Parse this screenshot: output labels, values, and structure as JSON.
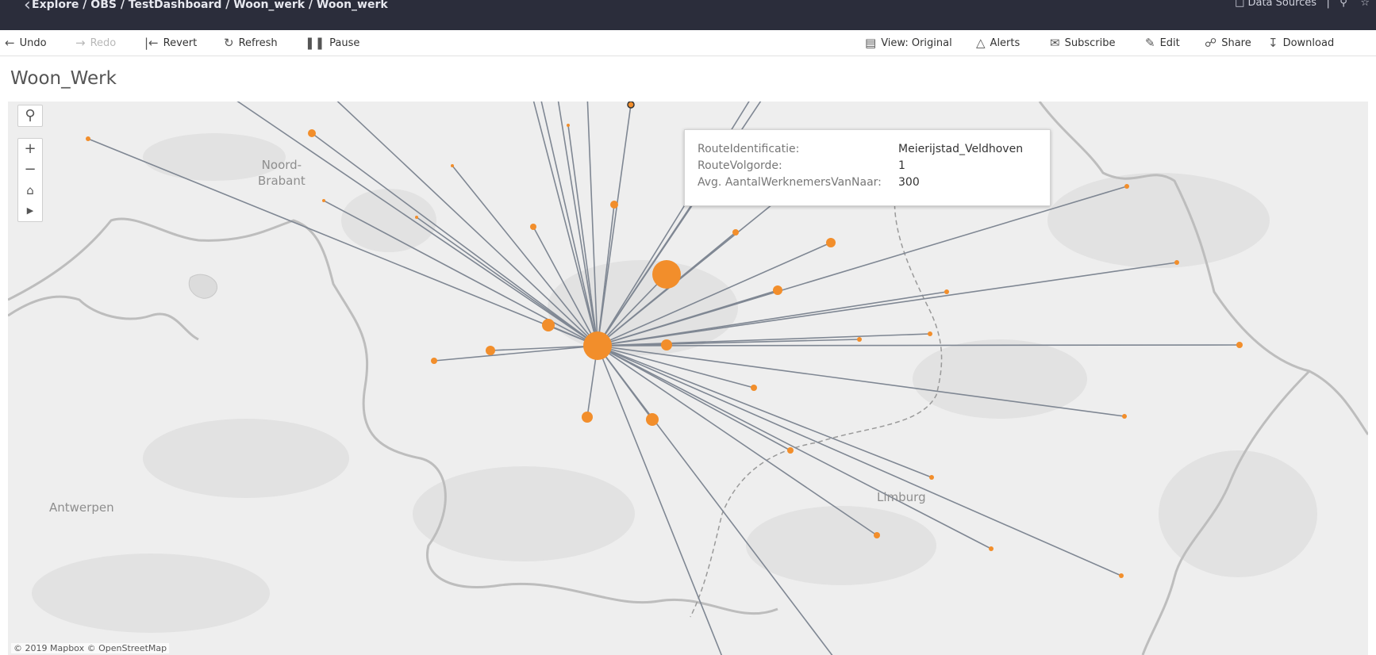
{
  "header": {
    "breadcrumb": "Explore / OBS / TestDashboard / Woon_werk / Woon_werk",
    "data_sources": "Data Sources"
  },
  "toolbar": {
    "undo": "Undo",
    "redo": "Redo",
    "revert": "Revert",
    "refresh": "Refresh",
    "pause": "Pause",
    "view": "View: Original",
    "alerts": "Alerts",
    "subscribe": "Subscribe",
    "edit": "Edit",
    "share": "Share",
    "download": "Download"
  },
  "sheet_title": "Woon_Werk",
  "map": {
    "labels": {
      "noord_brabant": "Noord-\nBrabant",
      "antwerpen": "Antwerpen",
      "limburg": "Limburg"
    },
    "attribution": "© 2019 Mapbox © OpenStreetMap",
    "controls": [
      "search-icon",
      "zoom-in-icon",
      "zoom-out-icon",
      "home-icon",
      "play-icon"
    ],
    "colors": {
      "marker": "#f28e2b",
      "route": "#7f8793",
      "background": "#eeeeee"
    }
  },
  "tooltip": {
    "rows": [
      {
        "key": "RouteIdentificatie:",
        "value": "Meierijstad_Veldhoven"
      },
      {
        "key": "RouteVolgorde:",
        "value": "1"
      },
      {
        "key": "Avg. AantalWerknemersVanNaar:",
        "value": "300"
      }
    ]
  }
}
